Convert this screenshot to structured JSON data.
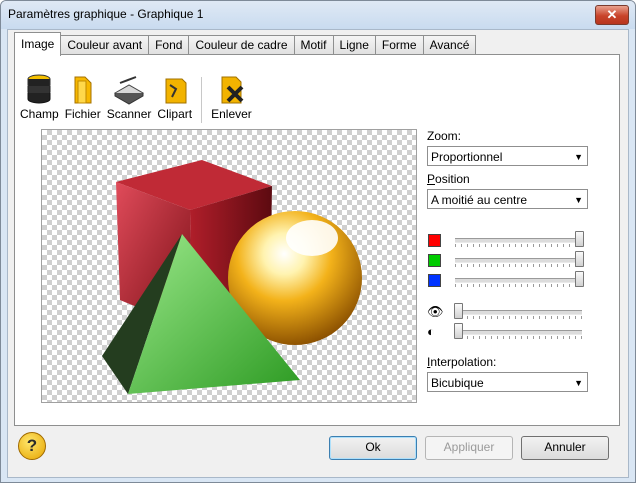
{
  "window": {
    "title": "Paramètres graphique - Graphique 1",
    "close_label": "✕"
  },
  "tabs": [
    {
      "label": "Image",
      "active": true
    },
    {
      "label": "Couleur avant"
    },
    {
      "label": "Fond"
    },
    {
      "label": "Couleur de cadre"
    },
    {
      "label": "Motif"
    },
    {
      "label": "Ligne"
    },
    {
      "label": "Forme"
    },
    {
      "label": "Avancé"
    }
  ],
  "toolbar": {
    "champ": "Champ",
    "fichier": "Fichier",
    "scanner": "Scanner",
    "clipart": "Clipart",
    "enlever": "Enlever"
  },
  "zoom": {
    "label": "Zoom:",
    "value": "Proportionnel"
  },
  "position": {
    "label_first": "P",
    "label_rest": "osition",
    "value": "A moitié au centre"
  },
  "sliders": {
    "red": 1.0,
    "green": 1.0,
    "blue": 1.0,
    "brightness": 0.0,
    "contrast": 0.0,
    "colors": {
      "red": "#ff0000",
      "green": "#00cc00",
      "blue": "#0033ff"
    }
  },
  "interpolation": {
    "label_first": "I",
    "label_rest": "nterpolation:",
    "value": "Bicubique"
  },
  "buttons": {
    "ok": "Ok",
    "apply": "Appliquer",
    "cancel": "Annuler",
    "help": "?"
  }
}
